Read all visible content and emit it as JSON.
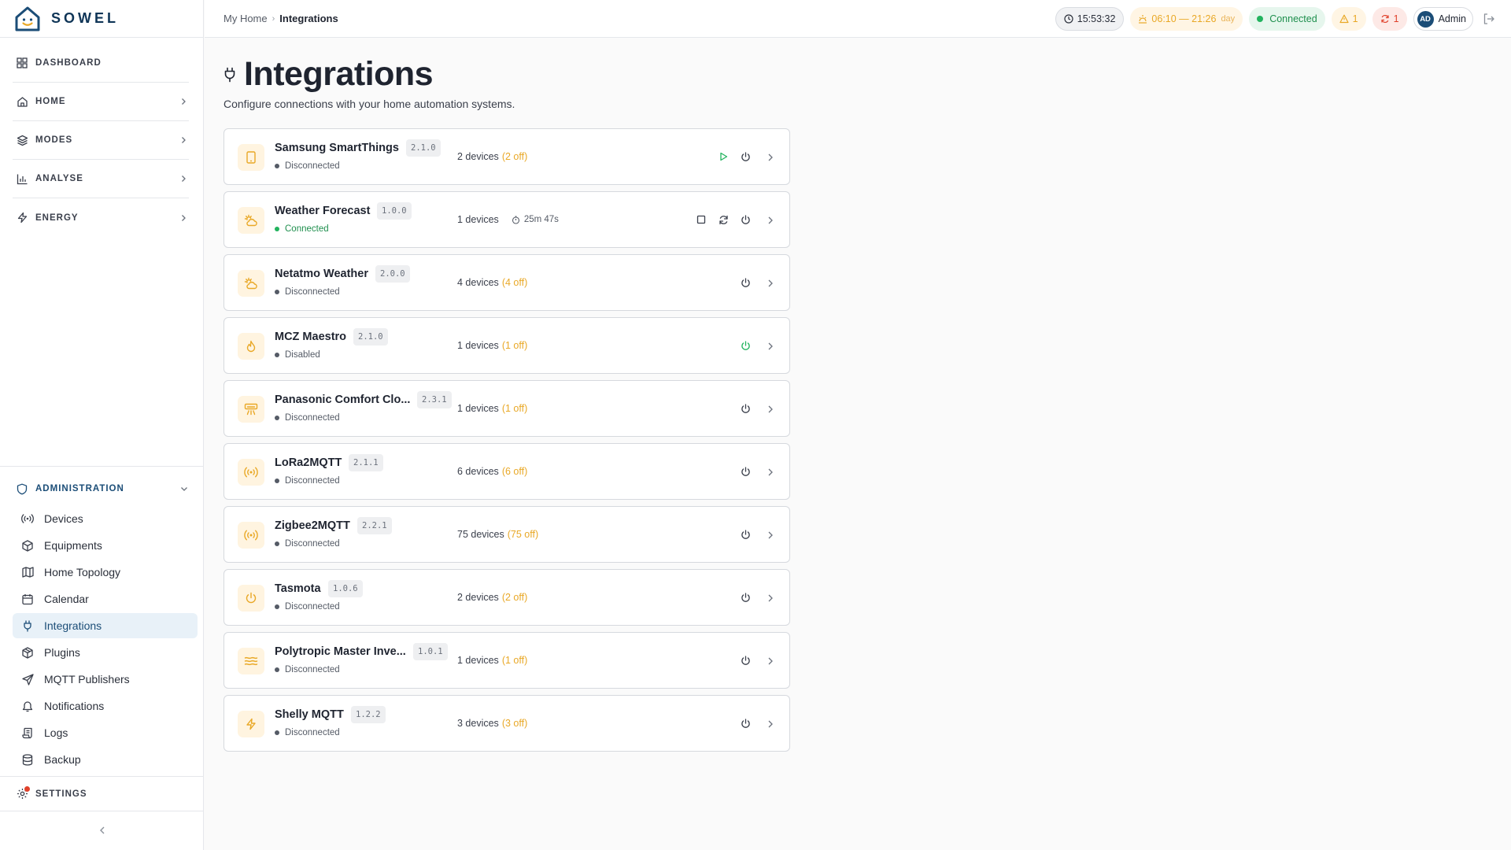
{
  "app": {
    "name": "SOWEL"
  },
  "sidebar": {
    "main": [
      {
        "key": "dashboard",
        "label": "DASHBOARD",
        "icon": "grid-icon",
        "chevron": false
      },
      {
        "key": "home",
        "label": "HOME",
        "icon": "house-icon",
        "chevron": true
      },
      {
        "key": "modes",
        "label": "MODES",
        "icon": "layers-icon",
        "chevron": true
      },
      {
        "key": "analyse",
        "label": "ANALYSE",
        "icon": "bar-chart-icon",
        "chevron": true
      },
      {
        "key": "energy",
        "label": "ENERGY",
        "icon": "lightning-icon",
        "chevron": true
      }
    ],
    "admin": {
      "label": "ADMINISTRATION",
      "items": [
        {
          "key": "devices",
          "label": "Devices",
          "icon": "radio-waves-icon"
        },
        {
          "key": "equipments",
          "label": "Equipments",
          "icon": "box-icon"
        },
        {
          "key": "home-topology",
          "label": "Home Topology",
          "icon": "map-icon"
        },
        {
          "key": "calendar",
          "label": "Calendar",
          "icon": "calendar-icon"
        },
        {
          "key": "integrations",
          "label": "Integrations",
          "icon": "plug-icon",
          "active": true
        },
        {
          "key": "plugins",
          "label": "Plugins",
          "icon": "package-icon"
        },
        {
          "key": "mqtt-publishers",
          "label": "MQTT Publishers",
          "icon": "send-icon"
        },
        {
          "key": "notifications",
          "label": "Notifications",
          "icon": "bell-icon"
        },
        {
          "key": "logs",
          "label": "Logs",
          "icon": "scroll-icon"
        },
        {
          "key": "backup",
          "label": "Backup",
          "icon": "database-icon"
        }
      ]
    },
    "settings": {
      "label": "SETTINGS"
    }
  },
  "topbar": {
    "breadcrumb": {
      "parent": "My Home",
      "current": "Integrations"
    },
    "time": "15:53:32",
    "sun": {
      "range": "06:10 — 21:26",
      "tag": "day"
    },
    "connection": "Connected",
    "warnings": "1",
    "errors": "1",
    "user": {
      "initials": "AD",
      "name": "Admin"
    }
  },
  "page": {
    "title": "Integrations",
    "subtitle": "Configure connections with your home automation systems."
  },
  "integrations": [
    {
      "name": "Samsung SmartThings",
      "version": "2.1.0",
      "status": "Disconnected",
      "devices": "2 devices",
      "off": "(2 off)",
      "icon": "tablet-icon",
      "actions": [
        "play",
        "power"
      ]
    },
    {
      "name": "Weather Forecast",
      "version": "1.0.0",
      "status": "Connected",
      "devices": "1 devices",
      "off": "",
      "timer": "25m 47s",
      "icon": "cloud-sun-icon",
      "actions": [
        "stop",
        "refresh",
        "power"
      ]
    },
    {
      "name": "Netatmo Weather",
      "version": "2.0.0",
      "status": "Disconnected",
      "devices": "4 devices",
      "off": "(4 off)",
      "icon": "cloud-sun-icon",
      "actions": [
        "power"
      ]
    },
    {
      "name": "MCZ Maestro",
      "version": "2.1.0",
      "status": "Disabled",
      "devices": "1 devices",
      "off": "(1 off)",
      "icon": "flame-icon",
      "actions": [
        "power-green"
      ]
    },
    {
      "name": "Panasonic Comfort Clo...",
      "version": "2.3.1",
      "status": "Disconnected",
      "devices": "1 devices",
      "off": "(1 off)",
      "icon": "air-conditioner-icon",
      "actions": [
        "power"
      ]
    },
    {
      "name": "LoRa2MQTT",
      "version": "2.1.1",
      "status": "Disconnected",
      "devices": "6 devices",
      "off": "(6 off)",
      "icon": "radio-waves-icon",
      "actions": [
        "power"
      ]
    },
    {
      "name": "Zigbee2MQTT",
      "version": "2.2.1",
      "status": "Disconnected",
      "devices": "75 devices",
      "off": "(75 off)",
      "icon": "radio-waves-icon",
      "actions": [
        "power"
      ]
    },
    {
      "name": "Tasmota",
      "version": "1.0.6",
      "status": "Disconnected",
      "devices": "2 devices",
      "off": "(2 off)",
      "icon": "power-icon",
      "actions": [
        "power"
      ]
    },
    {
      "name": "Polytropic Master Inve...",
      "version": "1.0.1",
      "status": "Disconnected",
      "devices": "1 devices",
      "off": "(1 off)",
      "icon": "waves-icon",
      "actions": [
        "power"
      ]
    },
    {
      "name": "Shelly MQTT",
      "version": "1.2.2",
      "status": "Disconnected",
      "devices": "3 devices",
      "off": "(3 off)",
      "icon": "lightning-icon",
      "actions": [
        "power"
      ]
    }
  ],
  "colors": {
    "accent": "#1b4d77",
    "warning": "#e9a826",
    "success": "#22b35e",
    "danger": "#e0412b"
  }
}
